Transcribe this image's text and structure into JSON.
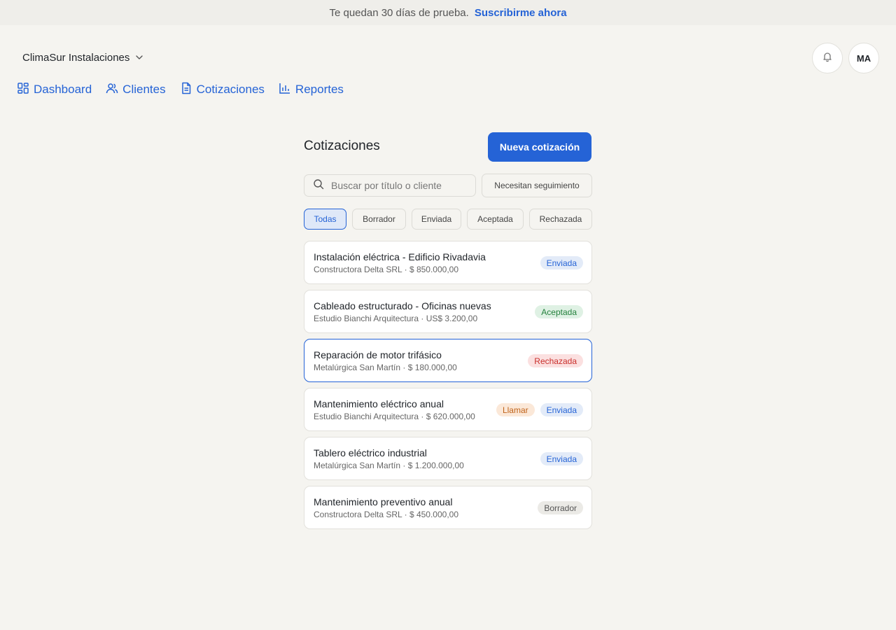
{
  "trial": {
    "message": "Te quedan 30 días de prueba.",
    "cta": "Suscribirme ahora"
  },
  "workspace": {
    "name": "ClimaSur Instalaciones"
  },
  "user": {
    "initials": "MA"
  },
  "nav": [
    {
      "label": "Dashboard",
      "icon": "dashboard-icon"
    },
    {
      "label": "Clientes",
      "icon": "users-icon"
    },
    {
      "label": "Cotizaciones",
      "icon": "document-icon"
    },
    {
      "label": "Reportes",
      "icon": "bar-chart-icon"
    }
  ],
  "page": {
    "title": "Cotizaciones",
    "new_button": "Nueva cotización",
    "search_placeholder": "Buscar por título o cliente",
    "follow_up_button": "Necesitan seguimiento"
  },
  "filters": [
    {
      "label": "Todas",
      "active": true
    },
    {
      "label": "Borrador",
      "active": false
    },
    {
      "label": "Enviada",
      "active": false
    },
    {
      "label": "Aceptada",
      "active": false
    },
    {
      "label": "Rechazada",
      "active": false
    }
  ],
  "quotes": [
    {
      "title": "Instalación eléctrica - Edificio Rivadavia",
      "subtitle": "Constructora Delta SRL · $ 850.000,00",
      "status": "Enviada",
      "flag": ""
    },
    {
      "title": "Cableado estructurado - Oficinas nuevas",
      "subtitle": "Estudio Bianchi Arquitectura · US$ 3.200,00",
      "status": "Aceptada",
      "flag": ""
    },
    {
      "title": "Reparación de motor trifásico",
      "subtitle": "Metalúrgica San Martín · $ 180.000,00",
      "status": "Rechazada",
      "flag": ""
    },
    {
      "title": "Mantenimiento eléctrico anual",
      "subtitle": "Estudio Bianchi Arquitectura · $ 620.000,00",
      "status": "Enviada",
      "flag": "Llamar"
    },
    {
      "title": "Tablero eléctrico industrial",
      "subtitle": "Metalúrgica San Martín · $ 1.200.000,00",
      "status": "Enviada",
      "flag": ""
    },
    {
      "title": "Mantenimiento preventivo anual",
      "subtitle": "Constructora Delta SRL · $ 450.000,00",
      "status": "Borrador",
      "flag": ""
    }
  ],
  "colors": {
    "accent": "#2563d6",
    "background": "#f5f4f0",
    "status_enviada": "#2563d6",
    "status_aceptada": "#24813d",
    "status_rechazada": "#c9302c",
    "status_borrador": "#555555",
    "flag_llamar": "#c0631a"
  }
}
